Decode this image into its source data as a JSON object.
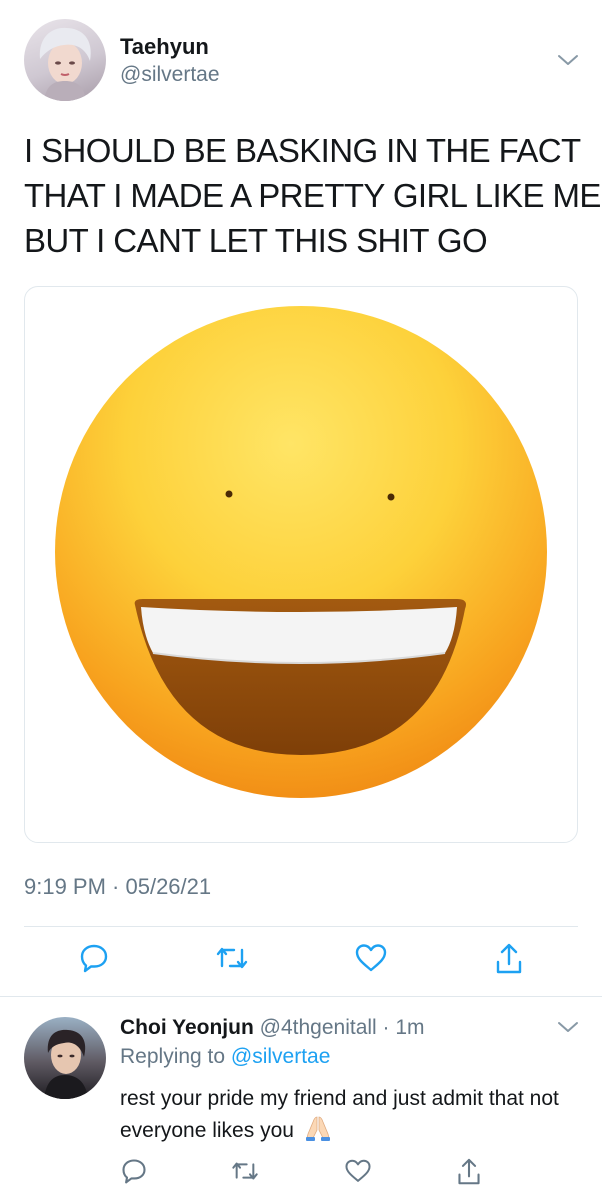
{
  "tweet": {
    "author_name": "Taehyun",
    "author_handle": "@silvertae",
    "text_lines": [
      "I SHOULD BE BASKING IN THE FACT",
      "THAT I MADE A PRETTY GIRL LIKE ME",
      "BUT I CANT LET THIS SHIT GO"
    ],
    "media_icon": "grinning-face-emoji",
    "timestamp": "9:19 PM · 05/26/21",
    "actions": [
      "reply-icon",
      "retweet-icon",
      "like-icon",
      "share-icon"
    ]
  },
  "reply": {
    "author_name": "Choi Yeonjun",
    "author_handle": "@4thgenitall",
    "time": "· 1m",
    "replying_prefix": "Replying to",
    "replying_to": "@silvertae",
    "text": "rest your pride my friend and just admit that not everyone likes you",
    "emoji_icon": "folded-hands-emoji",
    "actions": [
      "reply-icon",
      "retweet-icon",
      "like-icon",
      "share-icon"
    ]
  },
  "colors": {
    "text": "#14171a",
    "secondary": "#657786",
    "link": "#1da1f2",
    "border": "#e1e8ed"
  }
}
